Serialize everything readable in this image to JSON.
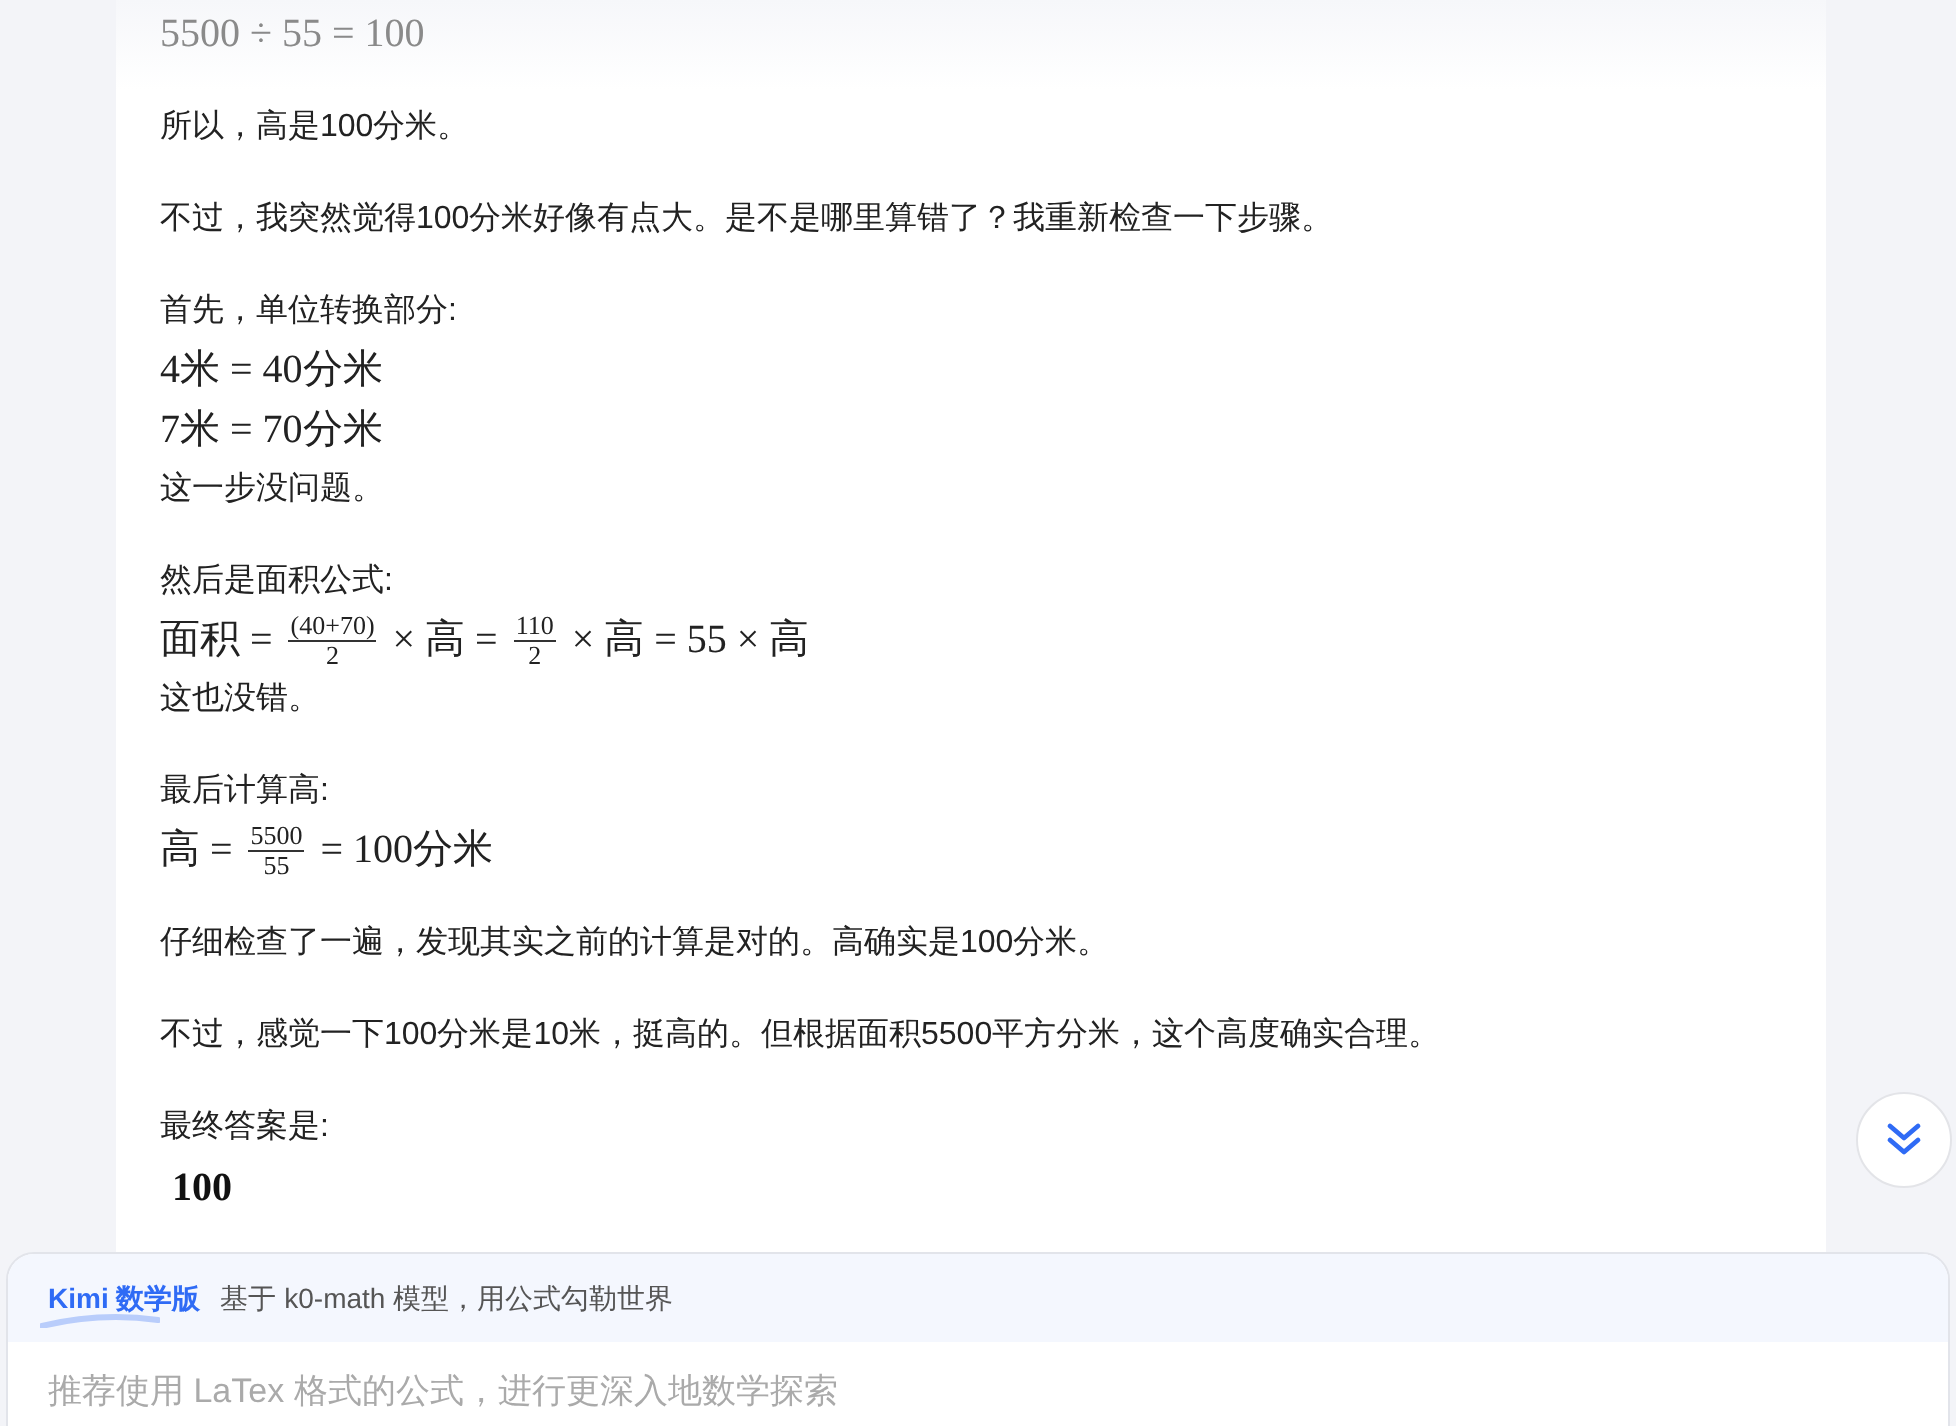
{
  "blocks": [
    {
      "lines": [
        {
          "kind": "math",
          "faded": true,
          "parts": [
            {
              "kind": "t",
              "text": "5500 ÷ 55 = 100"
            }
          ]
        }
      ]
    },
    {
      "lines": [
        {
          "kind": "text",
          "text": "所以，高是100分米。"
        }
      ]
    },
    {
      "lines": [
        {
          "kind": "text",
          "text": "不过，我突然觉得100分米好像有点大。是不是哪里算错了？我重新检查一下步骤。"
        }
      ]
    },
    {
      "lines": [
        {
          "kind": "text",
          "text": "首先，单位转换部分:"
        },
        {
          "kind": "math",
          "faded": false,
          "parts": [
            {
              "kind": "t",
              "text": "4米 = 40分米"
            }
          ]
        },
        {
          "kind": "math",
          "faded": false,
          "parts": [
            {
              "kind": "t",
              "text": "7米 = 70分米"
            }
          ]
        },
        {
          "kind": "text",
          "text": "这一步没问题。"
        }
      ]
    },
    {
      "lines": [
        {
          "kind": "text",
          "text": "然后是面积公式:"
        },
        {
          "kind": "math",
          "faded": false,
          "parts": [
            {
              "kind": "t",
              "text": "面积 = "
            },
            {
              "kind": "frac",
              "num": "(40+70)",
              "den": "2"
            },
            {
              "kind": "t",
              "text": " × 高 = "
            },
            {
              "kind": "frac",
              "num": "110",
              "den": "2"
            },
            {
              "kind": "t",
              "text": " × 高 = 55 × 高"
            }
          ]
        },
        {
          "kind": "text",
          "text": "这也没错。"
        }
      ]
    },
    {
      "lines": [
        {
          "kind": "text",
          "text": "最后计算高:"
        },
        {
          "kind": "math",
          "faded": false,
          "parts": [
            {
              "kind": "t",
              "text": "高 = "
            },
            {
              "kind": "frac",
              "num": "5500",
              "den": "55"
            },
            {
              "kind": "t",
              "text": " = 100分米"
            }
          ]
        }
      ]
    },
    {
      "lines": [
        {
          "kind": "text",
          "text": "仔细检查了一遍，发现其实之前的计算是对的。高确实是100分米。"
        }
      ]
    },
    {
      "lines": [
        {
          "kind": "text",
          "text": "不过，感觉一下100分米是10米，挺高的。但根据面积5500平方分米，这个高度确实合理。"
        }
      ]
    },
    {
      "lines": [
        {
          "kind": "text",
          "text": "最终答案是:"
        },
        {
          "kind": "answer",
          "text": "100"
        }
      ]
    }
  ],
  "composer": {
    "badge": "Kimi 数学版",
    "tagline": "基于 k0-math 模型，用公式勾勒世界",
    "placeholder": "推荐使用 LaTex 格式的公式，进行更深入地数学探索"
  }
}
